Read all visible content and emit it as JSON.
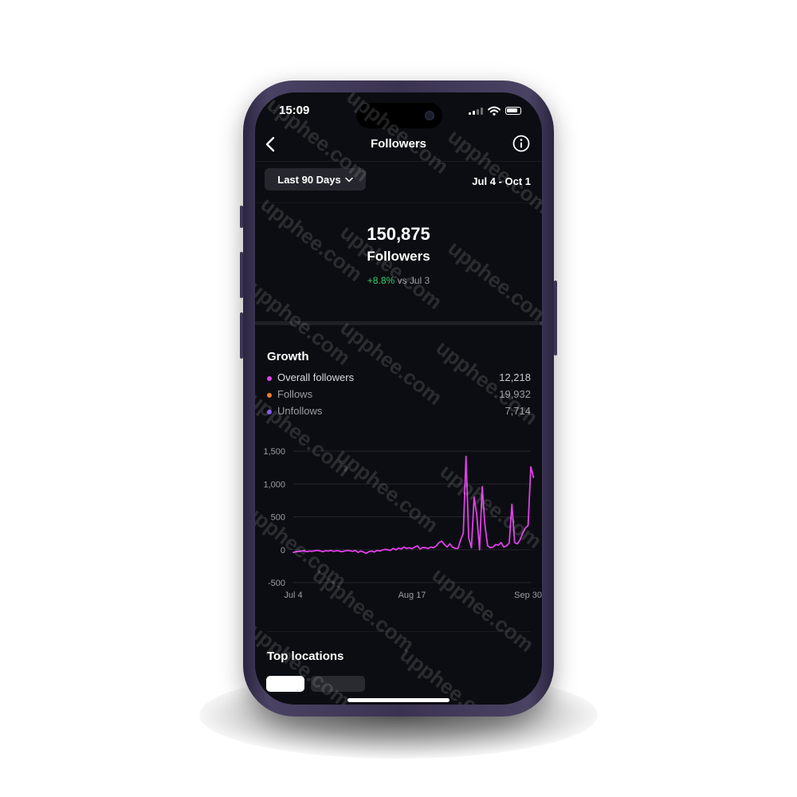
{
  "status_bar": {
    "time": "15:09"
  },
  "nav": {
    "title": "Followers"
  },
  "filter": {
    "range_label": "Last 90 Days",
    "date_range": "Jul 4 - Oct 1"
  },
  "summary": {
    "total": "150,875",
    "label": "Followers",
    "delta_pct": "+8.8%",
    "delta_suffix": "vs Jul 3"
  },
  "growth": {
    "title": "Growth",
    "legend": [
      {
        "label": "Overall followers",
        "value": "12,218",
        "color": "#e040e8"
      },
      {
        "label": "Follows",
        "value": "19,932",
        "color": "#f27a2a"
      },
      {
        "label": "Unfollows",
        "value": "7,714",
        "color": "#7a4cf0"
      }
    ]
  },
  "chart_data": {
    "type": "line",
    "ytick_labels": [
      "1,500",
      "1,000",
      "500",
      "0",
      "-500"
    ],
    "yticks": [
      1500,
      1000,
      500,
      0,
      -500
    ],
    "ylim": [
      -500,
      1500
    ],
    "xtick_labels": [
      "Jul 4",
      "Aug 17",
      "Sep 30"
    ],
    "xlim": [
      0,
      88
    ],
    "grid": true,
    "series": [
      {
        "name": "Overall followers",
        "color": "#e040e8",
        "values": [
          -40,
          -30,
          -25,
          -20,
          -15,
          -30,
          -20,
          -25,
          -15,
          -10,
          -20,
          -30,
          -15,
          -20,
          -10,
          -25,
          -15,
          -20,
          -30,
          -20,
          -10,
          -15,
          -25,
          -10,
          -40,
          -20,
          -35,
          -55,
          -30,
          -20,
          -35,
          -10,
          -20,
          -5,
          5,
          0,
          -10,
          20,
          0,
          25,
          10,
          40,
          20,
          30,
          15,
          40,
          60,
          10,
          35,
          30,
          20,
          40,
          30,
          60,
          110,
          130,
          80,
          40,
          90,
          40,
          20,
          20,
          150,
          250,
          1420,
          180,
          30,
          800,
          520,
          0,
          960,
          380,
          60,
          30,
          40,
          80,
          70,
          110,
          40,
          60,
          100,
          690,
          110,
          90,
          150,
          250,
          330,
          370,
          1260,
          1100
        ]
      }
    ]
  },
  "top_locations": {
    "title": "Top locations"
  },
  "watermark_text": "upphee.com"
}
